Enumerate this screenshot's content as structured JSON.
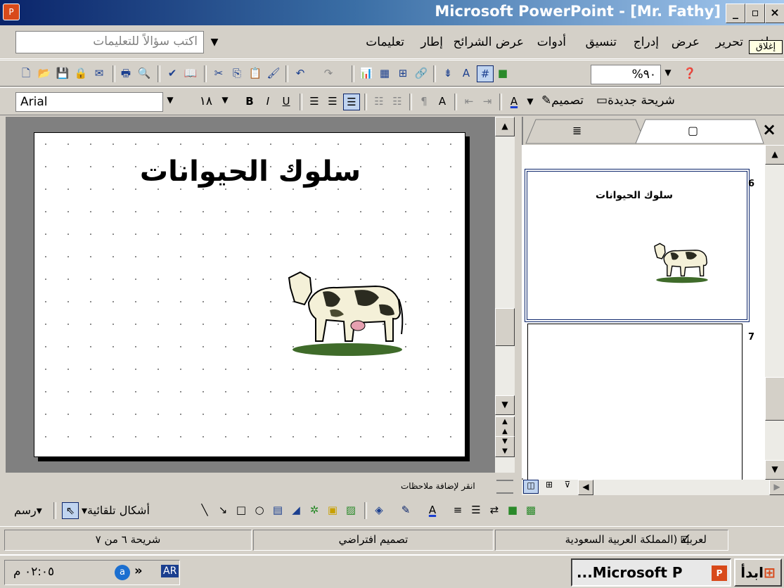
{
  "window": {
    "title": "Microsoft PowerPoint - [Mr. Fathy]",
    "app_icon": "powerpoint-icon"
  },
  "menu": {
    "items": [
      "ملف",
      "تحرير",
      "عرض",
      "إدراج",
      "تنسيق",
      "أدوات",
      "عرض الشرائح",
      "إطار",
      "تعليمات"
    ],
    "help_placeholder": "اكتب سؤالاً للتعليمات",
    "close_tooltip": "إغلاق"
  },
  "standard_toolbar": {
    "zoom": "%٩٠"
  },
  "formatting_toolbar": {
    "font": "Arial",
    "font_size": "١٨",
    "design_label": "تصميم",
    "new_slide_label": "شريحة جديدة"
  },
  "slide": {
    "title": "سلوك الحيوانات"
  },
  "thumbnails": {
    "tabs": [
      "outline-tab",
      "slides-tab"
    ],
    "items": [
      {
        "number": "6",
        "title": "سلوك الحيوانات"
      },
      {
        "number": "7",
        "title": ""
      }
    ]
  },
  "notes": {
    "placeholder": "انقر لإضافة ملاحظات"
  },
  "drawing_toolbar": {
    "draw_label": "رسم",
    "autoshapes_label": "أشكال تلقائية"
  },
  "status": {
    "slide_position": "شريحة ٦ من ٧",
    "design": "تصميم افتراضي",
    "language": "لعربية (المملكة العربية السعودية"
  },
  "taskbar": {
    "start_label": "ابدأ",
    "task_label": "...Microsoft P",
    "lang": "AR",
    "clock": "٠٢:٠٥ م"
  },
  "colors": {
    "title_gradient_start": "#0a246a",
    "title_gradient_end": "#a6caf0",
    "selected_border": "#0a246a"
  }
}
